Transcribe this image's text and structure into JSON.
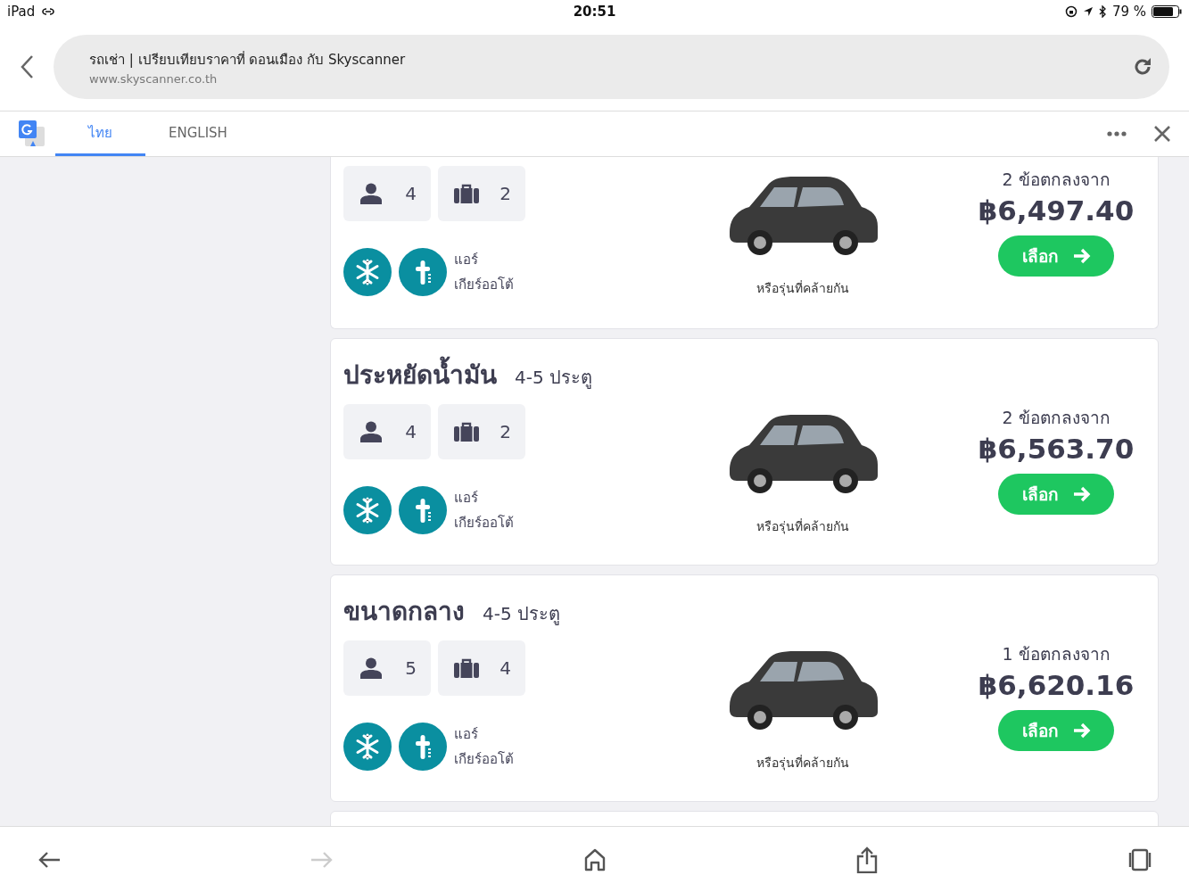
{
  "status_bar": {
    "device": "iPad",
    "time": "20:51",
    "battery": "79 %"
  },
  "address_bar": {
    "title": "รถเช่า | เปรียบเทียบราคาที่ ดอนเมือง กับ Skyscanner",
    "url": "www.skyscanner.co.th"
  },
  "translate_bar": {
    "tabs": [
      {
        "label": "ไทย",
        "selected": true
      },
      {
        "label": "ENGLISH",
        "selected": false
      }
    ]
  },
  "cards": [
    {
      "passengers": "4",
      "bags": "2",
      "features": [
        "แอร์",
        "เกียร์ออโต้"
      ],
      "caption": "หรือรุ่นที่คล้ายกัน",
      "deals": "2 ข้อตกลงจาก",
      "price": "฿6,497.40",
      "button": "เลือก"
    },
    {
      "title": "ประหยัดน้ำมัน",
      "doors": "4-5 ประตู",
      "passengers": "4",
      "bags": "2",
      "features": [
        "แอร์",
        "เกียร์ออโต้"
      ],
      "caption": "หรือรุ่นที่คล้ายกัน",
      "deals": "2 ข้อตกลงจาก",
      "price": "฿6,563.70",
      "button": "เลือก"
    },
    {
      "title": "ขนาดกลาง",
      "doors": "4-5 ประตู",
      "passengers": "5",
      "bags": "4",
      "features": [
        "แอร์",
        "เกียร์ออโต้"
      ],
      "caption": "หรือรุ่นที่คล้ายกัน",
      "deals": "1 ข้อตกลงจาก",
      "price": "฿6,620.16",
      "button": "เลือก"
    }
  ],
  "toolbar": [
    {
      "kind": "back",
      "disabled": false
    },
    {
      "kind": "forward",
      "disabled": true
    },
    {
      "kind": "home",
      "disabled": false
    },
    {
      "kind": "share",
      "disabled": false
    },
    {
      "kind": "tabs",
      "disabled": false
    }
  ]
}
